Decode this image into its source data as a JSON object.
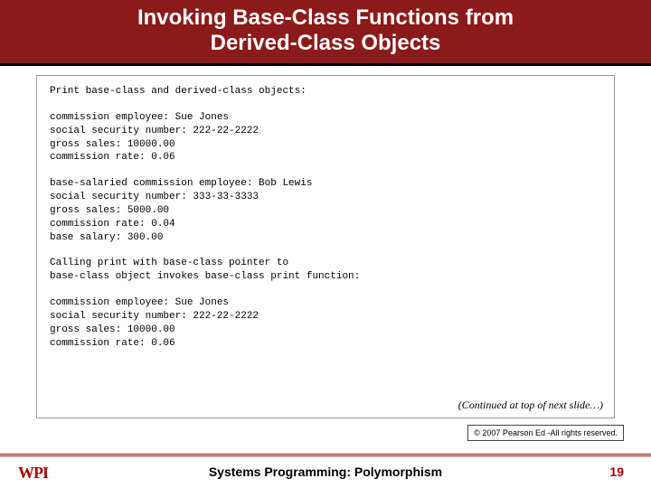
{
  "title_line1": "Invoking Base-Class Functions from",
  "title_line2": "Derived-Class Objects",
  "output": {
    "block1": "Print base-class and derived-class objects:",
    "block2": "commission employee: Sue Jones\nsocial security number: 222-22-2222\ngross sales: 10000.00\ncommission rate: 0.06",
    "block3": "base-salaried commission employee: Bob Lewis\nsocial security number: 333-33-3333\ngross sales: 5000.00\ncommission rate: 0.04\nbase salary: 300.00",
    "block4": "Calling print with base-class pointer to\nbase-class object invokes base-class print function:",
    "block5": "commission employee: Sue Jones\nsocial security number: 222-22-2222\ngross sales: 10000.00\ncommission rate: 0.06"
  },
  "continued_note": "(Continued at top of next slide…)",
  "copyright": "© 2007 Pearson Ed -All rights reserved.",
  "logo_text": "WPI",
  "footer_title": "Systems Programming: Polymorphism",
  "page_number": "19"
}
